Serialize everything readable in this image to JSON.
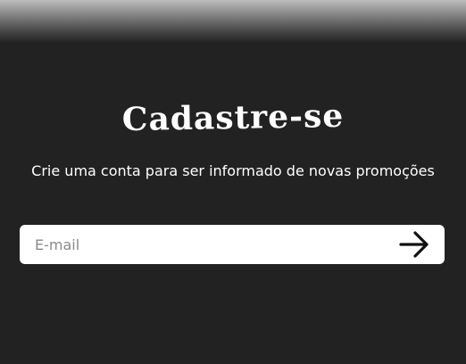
{
  "page": {
    "title": "Cadastre-se",
    "subtitle": "Crie uma conta para ser informado de novas promoções"
  },
  "form": {
    "email_placeholder": "E-mail",
    "email_value": "",
    "submit_icon": "arrow-right-icon"
  },
  "colors": {
    "background": "#222222",
    "text": "#ffffff",
    "input_background": "#ffffff",
    "placeholder": "#8a8a8a",
    "icon": "#111111"
  }
}
